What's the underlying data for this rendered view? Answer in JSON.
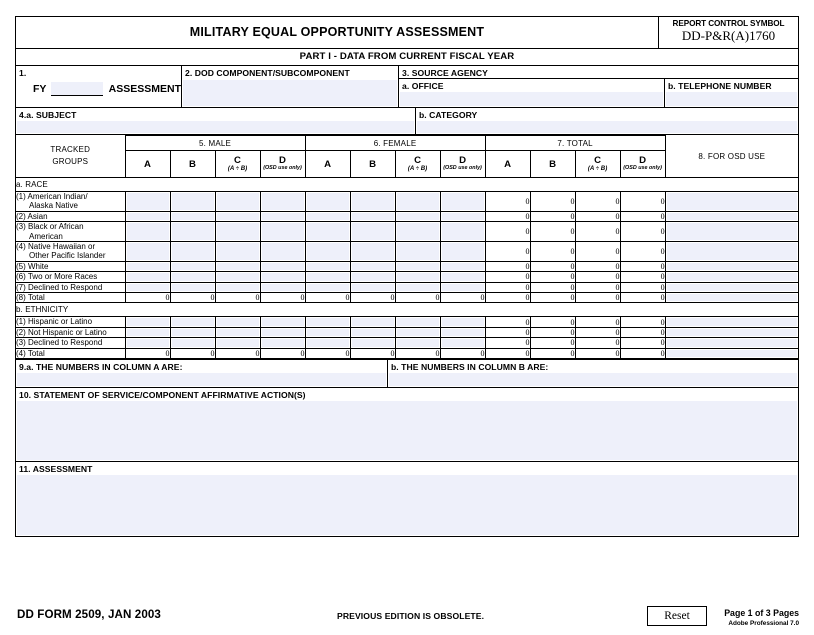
{
  "header": {
    "title": "MILITARY EQUAL OPPORTUNITY ASSESSMENT",
    "rcs_label": "REPORT CONTROL SYMBOL",
    "rcs_value": "DD-P&R(A)1760",
    "part_bar": "PART I - DATA FROM CURRENT FISCAL YEAR"
  },
  "block1": {
    "number": "1.",
    "fy_label": "FY",
    "fy_value": "",
    "assessment_label": "ASSESSMENT"
  },
  "block2": {
    "label": "2.  DOD COMPONENT/SUBCOMPONENT",
    "value": ""
  },
  "block3": {
    "label": "3.  SOURCE AGENCY",
    "office_label": "a.  OFFICE",
    "office_value": "",
    "phone_label": "b.  TELEPHONE NUMBER",
    "phone_value": ""
  },
  "block4": {
    "subject_label": "4.a. SUBJECT",
    "subject_value": "",
    "category_label": "b.  CATEGORY",
    "category_value": ""
  },
  "table": {
    "tracked_groups_l1": "TRACKED",
    "tracked_groups_l2": "GROUPS",
    "groups": [
      {
        "label": "5.  MALE"
      },
      {
        "label": "6.  FEMALE"
      },
      {
        "label": "7.  TOTAL"
      }
    ],
    "osd_group_label": "8.  FOR OSD USE",
    "subcols": [
      {
        "main": "A",
        "den": ""
      },
      {
        "main": "B",
        "den": ""
      },
      {
        "main": "C",
        "den": "(A ÷ B)"
      },
      {
        "main": "D",
        "den": "(OSD use only)"
      }
    ],
    "section_a_label": "a.  RACE",
    "section_b_label": "b.  ETHNICITY",
    "race_rows": [
      {
        "label_l1": "(1) American Indian/",
        "label_l2": "Alaska Native",
        "total": [
          "0",
          "0",
          "0",
          "0"
        ]
      },
      {
        "label_l1": "(2) Asian",
        "label_l2": "",
        "total": [
          "0",
          "0",
          "0",
          "0"
        ]
      },
      {
        "label_l1": "(3) Black or African",
        "label_l2": "American",
        "total": [
          "0",
          "0",
          "0",
          "0"
        ]
      },
      {
        "label_l1": "(4) Native Hawaiian or",
        "label_l2": "Other Pacific Islander",
        "total": [
          "0",
          "0",
          "0",
          "0"
        ]
      },
      {
        "label_l1": "(5) White",
        "label_l2": "",
        "total": [
          "0",
          "0",
          "0",
          "0"
        ]
      },
      {
        "label_l1": "(6) Two or More Races",
        "label_l2": "",
        "total": [
          "0",
          "0",
          "0",
          "0"
        ]
      },
      {
        "label_l1": "(7) Declined to Respond",
        "label_l2": "",
        "total": [
          "0",
          "0",
          "0",
          "0"
        ]
      }
    ],
    "race_total_row": {
      "label_l1": "(8) Total",
      "label_l2": "",
      "male": [
        "0",
        "0",
        "0",
        "0"
      ],
      "female": [
        "0",
        "0",
        "0",
        "0"
      ],
      "total": [
        "0",
        "0",
        "0",
        "0"
      ]
    },
    "ethnicity_rows": [
      {
        "label_l1": "(1) Hispanic or Latino",
        "label_l2": "",
        "total": [
          "0",
          "0",
          "0",
          "0"
        ]
      },
      {
        "label_l1": "(2) Not Hispanic or Latino",
        "label_l2": "",
        "total": [
          "0",
          "0",
          "0",
          "0"
        ]
      },
      {
        "label_l1": "(3) Declined to Respond",
        "label_l2": "",
        "total": [
          "0",
          "0",
          "0",
          "0"
        ]
      }
    ],
    "ethnicity_total_row": {
      "label_l1": "(4) Total",
      "label_l2": "",
      "male": [
        "0",
        "0",
        "0",
        "0"
      ],
      "female": [
        "0",
        "0",
        "0",
        "0"
      ],
      "total": [
        "0",
        "0",
        "0",
        "0"
      ]
    }
  },
  "block9": {
    "a_label": "9.a. THE NUMBERS IN COLUMN A ARE:",
    "a_value": "",
    "b_label": "b.  THE NUMBERS IN COLUMN B ARE:",
    "b_value": ""
  },
  "block10": {
    "label": "10. STATEMENT OF SERVICE/COMPONENT AFFIRMATIVE ACTION(S)",
    "value": ""
  },
  "block11": {
    "label": "11. ASSESSMENT",
    "value": ""
  },
  "footer": {
    "form_id": "DD FORM 2509, JAN 2003",
    "previous_edition": "PREVIOUS EDITION IS OBSOLETE.",
    "reset_label": "Reset",
    "page_label": "Page 1 of 3 Pages",
    "producer": "Adobe Professional 7.0"
  },
  "colors": {
    "field_fill": "#eef0fa",
    "border": "#000000",
    "page": "#ffffff"
  }
}
